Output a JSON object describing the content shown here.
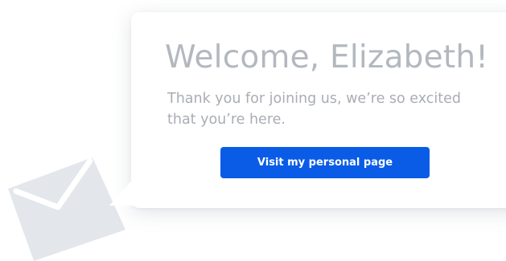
{
  "welcome": {
    "title": "Welcome, Elizabeth!",
    "message": "Thank you for joining us, we’re so excited that you’re here.",
    "cta_label": "Visit my personal page"
  },
  "illustration": {
    "icon": "envelope-icon",
    "color": "#e3e7ec"
  },
  "colors": {
    "accent": "#0a5ce6",
    "title_text": "#b3b8bf",
    "body_text": "#a9adb3",
    "background": "#ffffff"
  }
}
